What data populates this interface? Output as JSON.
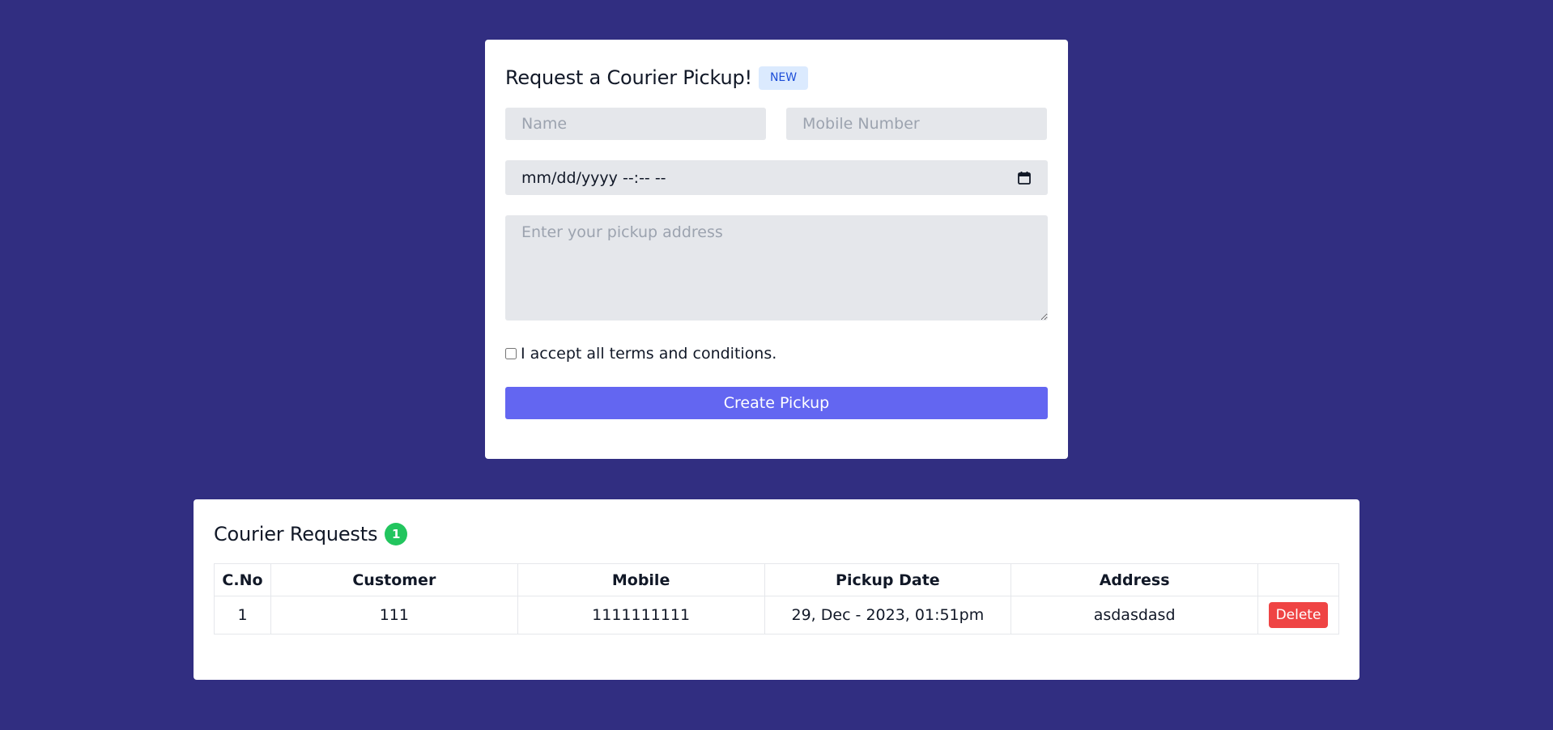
{
  "colors": {
    "background": "#312e81",
    "primary_button": "#6366f1",
    "new_badge_bg": "#dbeafe",
    "new_badge_text": "#1d4ed8",
    "count_badge": "#22c55e",
    "delete_button": "#ef4444"
  },
  "pickup_form": {
    "title": "Request a Courier Pickup!",
    "badge": "NEW",
    "name_placeholder": "Name",
    "name_value": "",
    "mobile_placeholder": "Mobile Number",
    "mobile_value": "",
    "datetime_placeholder": "mm/dd/yyyy --:-- --",
    "calendar_icon": "calendar-icon",
    "address_placeholder": "Enter your pickup address",
    "address_value": "",
    "terms_label": "I accept all terms and conditions.",
    "terms_checked": false,
    "submit_label": "Create Pickup"
  },
  "requests": {
    "title": "Courier Requests",
    "count": "1",
    "columns": [
      "C.No",
      "Customer",
      "Mobile",
      "Pickup Date",
      "Address",
      ""
    ],
    "rows": [
      {
        "cno": "1",
        "customer": "111",
        "mobile": "1111111111",
        "pickup_date": "29, Dec - 2023, 01:51pm",
        "address": "asdasdasd",
        "action_label": "Delete"
      }
    ]
  }
}
